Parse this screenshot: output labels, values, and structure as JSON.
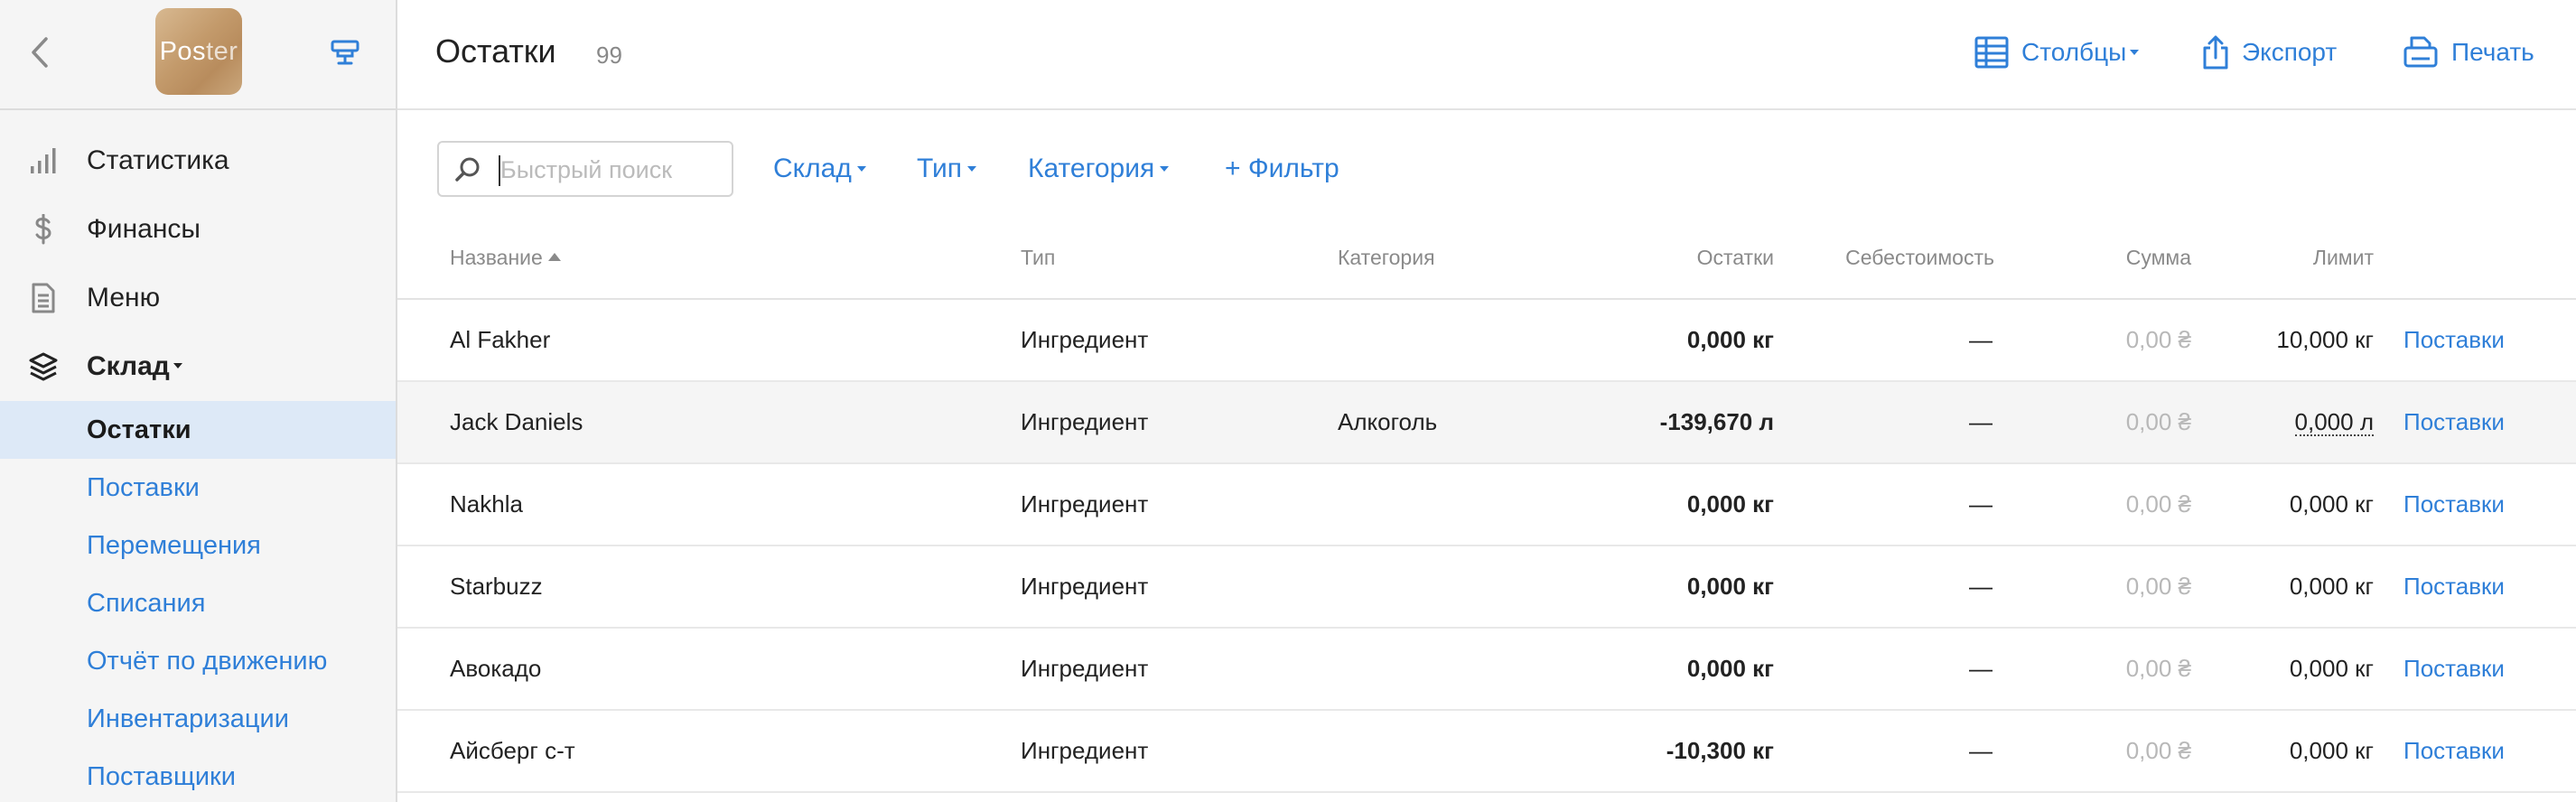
{
  "sidebar": {
    "logo_main": "Pos",
    "logo_light": "ter",
    "nav": [
      {
        "label": "Статистика",
        "icon": "bar-chart-icon"
      },
      {
        "label": "Финансы",
        "icon": "dollar-icon"
      },
      {
        "label": "Меню",
        "icon": "document-icon"
      },
      {
        "label": "Склад",
        "icon": "layers-icon"
      }
    ],
    "sub": [
      {
        "label": "Остатки",
        "active": true
      },
      {
        "label": "Поставки"
      },
      {
        "label": "Перемещения"
      },
      {
        "label": "Списания"
      },
      {
        "label": "Отчёт по движению"
      },
      {
        "label": "Инвентаризации"
      },
      {
        "label": "Поставщики"
      }
    ]
  },
  "header": {
    "title": "Остатки",
    "count": "99",
    "columns_label": "Столбцы",
    "export_label": "Экспорт",
    "print_label": "Печать"
  },
  "filters": {
    "search_placeholder": "Быстрый поиск",
    "warehouse": "Склад",
    "type": "Тип",
    "category": "Категория",
    "add_filter": "+ Фильтр"
  },
  "table": {
    "columns": {
      "name": "Название",
      "type": "Тип",
      "category": "Категория",
      "stock": "Остатки",
      "cost": "Себестоимость",
      "sum": "Сумма",
      "limit": "Лимит"
    },
    "rows": [
      {
        "name": "Al Fakher",
        "type": "Ингредиент",
        "category": "",
        "stock": "0,000 кг",
        "cost": "—",
        "sum": "0,00 ₴",
        "limit": "10,000 кг",
        "action": "Поставки"
      },
      {
        "name": "Jack Daniels",
        "type": "Ингредиент",
        "category": "Алкоголь",
        "stock": "-139,670 л",
        "cost": "—",
        "sum": "0,00 ₴",
        "limit": "0,000 л",
        "action": "Поставки"
      },
      {
        "name": "Nakhla",
        "type": "Ингредиент",
        "category": "",
        "stock": "0,000 кг",
        "cost": "—",
        "sum": "0,00 ₴",
        "limit": "0,000 кг",
        "action": "Поставки"
      },
      {
        "name": "Starbuzz",
        "type": "Ингредиент",
        "category": "",
        "stock": "0,000 кг",
        "cost": "—",
        "sum": "0,00 ₴",
        "limit": "0,000 кг",
        "action": "Поставки"
      },
      {
        "name": "Авокадо",
        "type": "Ингредиент",
        "category": "",
        "stock": "0,000 кг",
        "cost": "—",
        "sum": "0,00 ₴",
        "limit": "0,000 кг",
        "action": "Поставки"
      },
      {
        "name": "Айсберг с-т",
        "type": "Ингредиент",
        "category": "",
        "stock": "-10,300 кг",
        "cost": "—",
        "sum": "0,00 ₴",
        "limit": "0,000 кг",
        "action": "Поставки"
      }
    ]
  },
  "colors": {
    "accent": "#2f7fd8",
    "active_bg": "#dde9f7"
  }
}
